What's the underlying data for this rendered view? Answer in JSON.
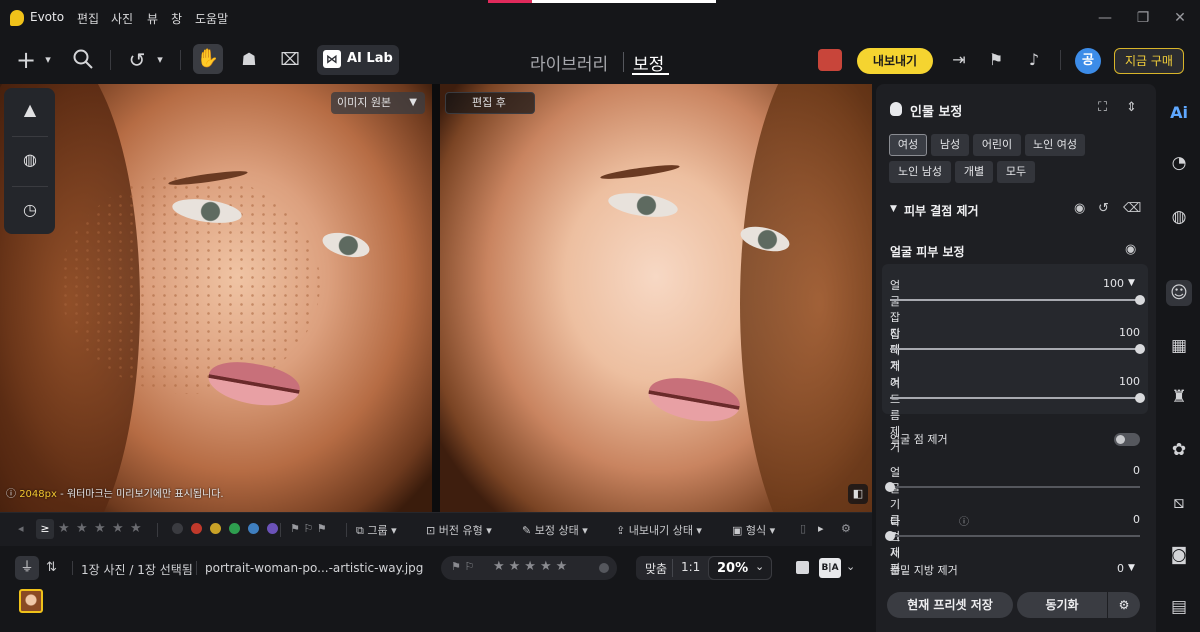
{
  "app": {
    "name": "Evoto"
  },
  "menu": [
    "편집",
    "사진",
    "뷰",
    "창",
    "도움말"
  ],
  "window": {
    "minimize": "—",
    "restore": "❐",
    "close": "✕"
  },
  "toolbar": {
    "ai_lab": "AI Lab",
    "mode_tabs": [
      "라이브러리",
      "보정"
    ],
    "active_tab": "보정",
    "export": "내보내기",
    "avatar": "공",
    "buy": "지금 구매"
  },
  "canvas": {
    "original_select": "이미지 원본",
    "after_label": "편집 후",
    "watermark_size": "2048px",
    "watermark_text": " - 워터마크는 미리보기에만 표시됩니다."
  },
  "filterbar": {
    "rating_op": "≥",
    "items": [
      "그룹",
      "버전 유형",
      "보정 상태",
      "내보내기 상태",
      "형식"
    ],
    "color_labels": [
      "#3a3b40",
      "#c0392b",
      "#c9a227",
      "#2e9e4f",
      "#3f7fc0",
      "#6b52b8"
    ]
  },
  "infobar": {
    "count": "1장 사진 / 1장 선택됨",
    "filename": "portrait-woman-po...-artistic-way.jpg",
    "fit": "맞춤",
    "one_to_one": "1:1",
    "zoom": "20%"
  },
  "panel": {
    "title": "인물 보정",
    "chips": [
      "여성",
      "남성",
      "어린이",
      "노인 여성",
      "노인 남성",
      "개별",
      "모두"
    ],
    "section": "피부 결점 제거",
    "subsection": "얼굴 피부 보정",
    "sliders": [
      {
        "label": "얼굴 잡티 제거",
        "value": "100",
        "fraction": 1.0
      },
      {
        "label": "잡티 제거",
        "value": "100",
        "fraction": 1.0
      },
      {
        "label": "여드름 제거",
        "value": "100",
        "fraction": 1.0
      }
    ],
    "toggle_label": "얼굴 점 제거",
    "sliders2": [
      {
        "label": "얼굴 기름기 제거",
        "value": "0",
        "fraction": 0
      },
      {
        "label": "다크서클 제거",
        "value": "0",
        "fraction": 0
      }
    ],
    "last_label": "눈밑 지방 제거",
    "last_value": "0",
    "save_preset": "현재 프리셋 저장",
    "sync": "동기화"
  },
  "rail": {
    "ai": "Ai"
  }
}
